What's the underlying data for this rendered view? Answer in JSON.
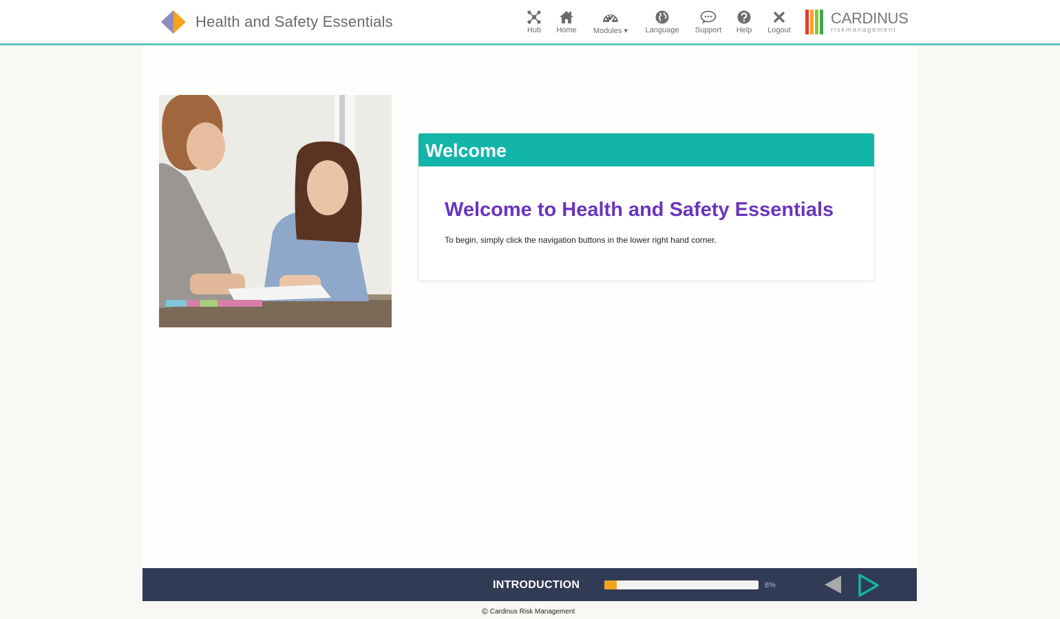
{
  "header": {
    "app_title": "Health and Safety Essentials",
    "nav": [
      {
        "icon": "hub-icon",
        "label": "Hub"
      },
      {
        "icon": "home-icon",
        "label": "Home"
      },
      {
        "icon": "dashboard-icon",
        "label": "Modules ▾"
      },
      {
        "icon": "globe-icon",
        "label": "Language"
      },
      {
        "icon": "chat-icon",
        "label": "Support"
      },
      {
        "icon": "question-icon",
        "label": "Help"
      },
      {
        "icon": "close-icon",
        "label": "Logout"
      }
    ],
    "brand": {
      "name": "CARDINUS",
      "subtitle": "riskmanagement",
      "bar_colors": [
        "#e63a2e",
        "#f4a51d",
        "#8cc540",
        "#41a847"
      ]
    }
  },
  "welcome": {
    "header": "Welcome",
    "heading": "Welcome to Health and Safety Essentials",
    "text": "To begin, simply click the navigation buttons in the lower right hand corner."
  },
  "footer": {
    "section_title": "INTRODUCTION",
    "progress_fraction": 0.08,
    "progress_label": "8%",
    "copyright": "Cardinus Risk Management"
  },
  "colors": {
    "teal": "#13b5a9",
    "purple": "#6a35bb",
    "footer_bg": "#323b55",
    "progress": "#f4a51d"
  }
}
